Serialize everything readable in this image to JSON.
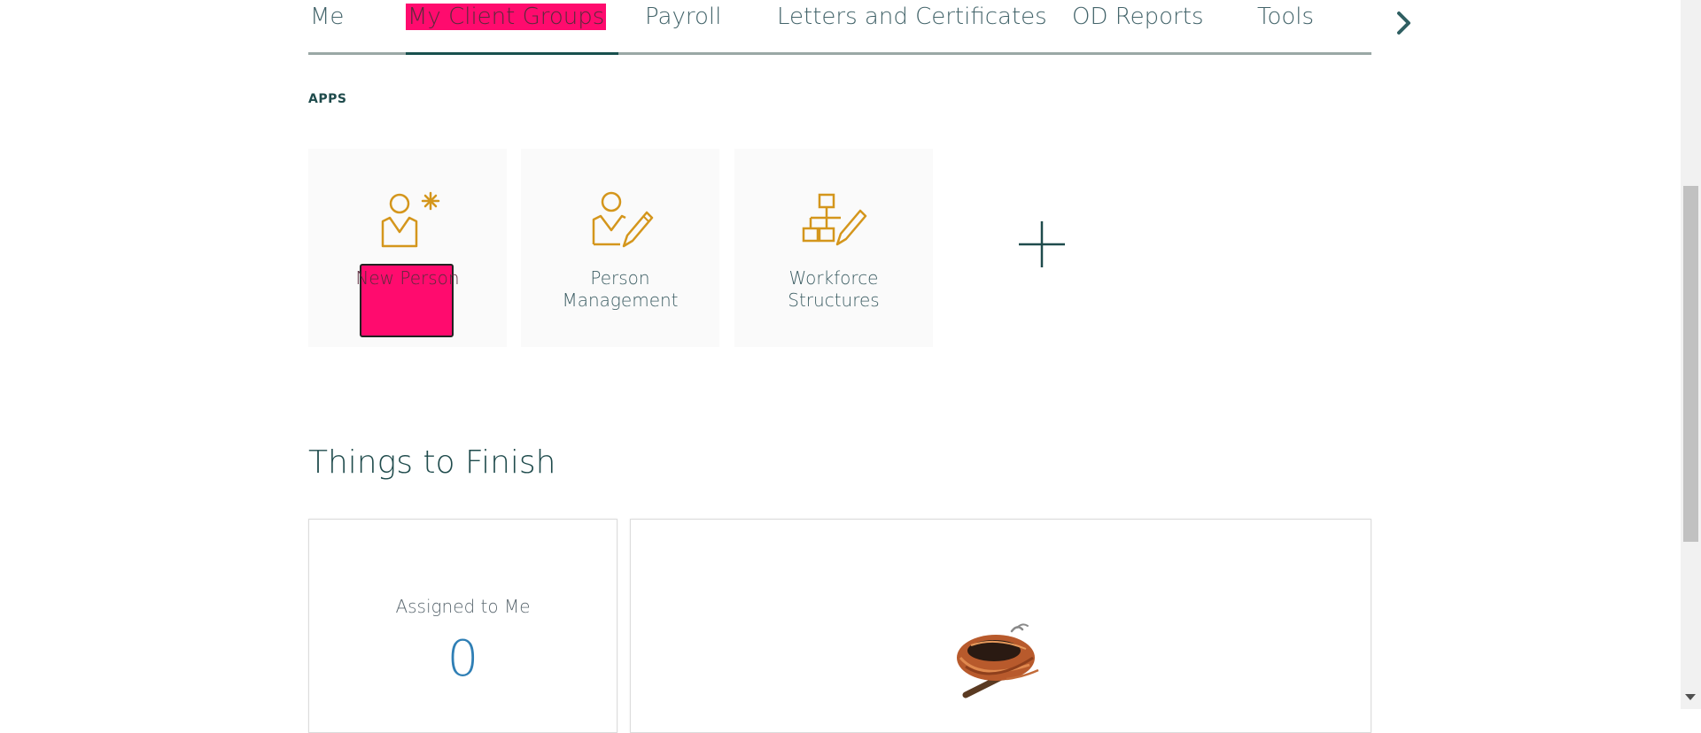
{
  "nav": {
    "tabs": [
      {
        "label": "Me"
      },
      {
        "label": "My Client Groups"
      },
      {
        "label": "Payroll"
      },
      {
        "label": "Letters and Certificates"
      },
      {
        "label": "OD Reports"
      },
      {
        "label": "Tools"
      }
    ],
    "active_tab": "My Client Groups",
    "next_icon": "chevron-right-icon"
  },
  "apps": {
    "section_label": "APPS",
    "tiles": [
      {
        "line1": "New Person",
        "line2": "",
        "icon": "person-add-icon"
      },
      {
        "line1": "Person",
        "line2": "Management",
        "icon": "person-edit-icon"
      },
      {
        "line1": "Workforce",
        "line2": "Structures",
        "icon": "org-chart-edit-icon"
      }
    ],
    "add_icon": "plus-icon"
  },
  "things_to_finish": {
    "title": "Things to Finish",
    "assigned_title": "Assigned to Me",
    "assigned_count": "0",
    "empty_illustration": "empty-nest-icon"
  },
  "colors": {
    "accent_dark": "#1f4b4c",
    "icon_gold": "#d4961c",
    "highlight": "#ff0b6e",
    "count_blue": "#2f7fb5"
  }
}
